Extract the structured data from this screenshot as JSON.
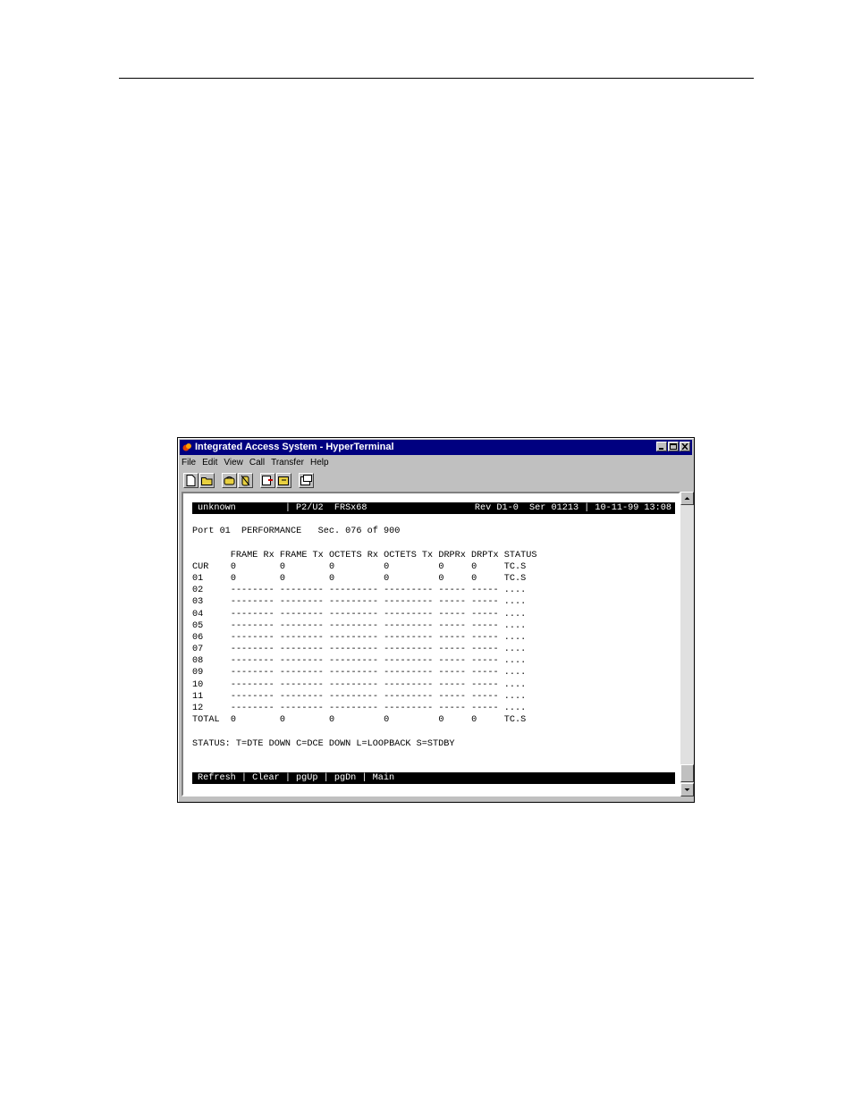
{
  "window": {
    "title": "Integrated Access System - HyperTerminal",
    "menu": [
      "File",
      "Edit",
      "View",
      "Call",
      "Transfer",
      "Help"
    ],
    "toolbar_icons": [
      "new-icon",
      "open-icon",
      "connect-icon",
      "disconnect-icon",
      "send-icon",
      "receive-icon",
      "properties-icon"
    ]
  },
  "terminal": {
    "status_bar": {
      "left": "unknown         | P2/U2  FRSx68",
      "right": "Rev D1-0  Ser 01213 | 10-11-99 13:08"
    },
    "heading": "Port 01  PERFORMANCE   Sec. 076 of 900",
    "columns": [
      "FRAME Rx",
      "FRAME Tx",
      "OCTETS Rx",
      "OCTETS Tx",
      "DRPRx",
      "DRPTx",
      "STATUS"
    ],
    "rows": [
      {
        "label": "CUR",
        "values": [
          "0",
          "0",
          "0",
          "0",
          "0",
          "0",
          "TC.S"
        ]
      },
      {
        "label": "01",
        "values": [
          "0",
          "0",
          "0",
          "0",
          "0",
          "0",
          "TC.S"
        ]
      },
      {
        "label": "02",
        "values": [
          "--------",
          "--------",
          "---------",
          "---------",
          "-----",
          "-----",
          "...."
        ]
      },
      {
        "label": "03",
        "values": [
          "--------",
          "--------",
          "---------",
          "---------",
          "-----",
          "-----",
          "...."
        ]
      },
      {
        "label": "04",
        "values": [
          "--------",
          "--------",
          "---------",
          "---------",
          "-----",
          "-----",
          "...."
        ]
      },
      {
        "label": "05",
        "values": [
          "--------",
          "--------",
          "---------",
          "---------",
          "-----",
          "-----",
          "...."
        ]
      },
      {
        "label": "06",
        "values": [
          "--------",
          "--------",
          "---------",
          "---------",
          "-----",
          "-----",
          "...."
        ]
      },
      {
        "label": "07",
        "values": [
          "--------",
          "--------",
          "---------",
          "---------",
          "-----",
          "-----",
          "...."
        ]
      },
      {
        "label": "08",
        "values": [
          "--------",
          "--------",
          "---------",
          "---------",
          "-----",
          "-----",
          "...."
        ]
      },
      {
        "label": "09",
        "values": [
          "--------",
          "--------",
          "---------",
          "---------",
          "-----",
          "-----",
          "...."
        ]
      },
      {
        "label": "10",
        "values": [
          "--------",
          "--------",
          "---------",
          "---------",
          "-----",
          "-----",
          "...."
        ]
      },
      {
        "label": "11",
        "values": [
          "--------",
          "--------",
          "---------",
          "---------",
          "-----",
          "-----",
          "...."
        ]
      },
      {
        "label": "12",
        "values": [
          "--------",
          "--------",
          "---------",
          "---------",
          "-----",
          "-----",
          "...."
        ]
      },
      {
        "label": "TOTAL",
        "values": [
          "0",
          "0",
          "0",
          "0",
          "0",
          "0",
          "TC.S"
        ]
      }
    ],
    "legend": "STATUS: T=DTE DOWN C=DCE DOWN L=LOOPBACK S=STDBY",
    "command_bar": "Refresh | Clear | pgUp | pgDn | Main"
  }
}
